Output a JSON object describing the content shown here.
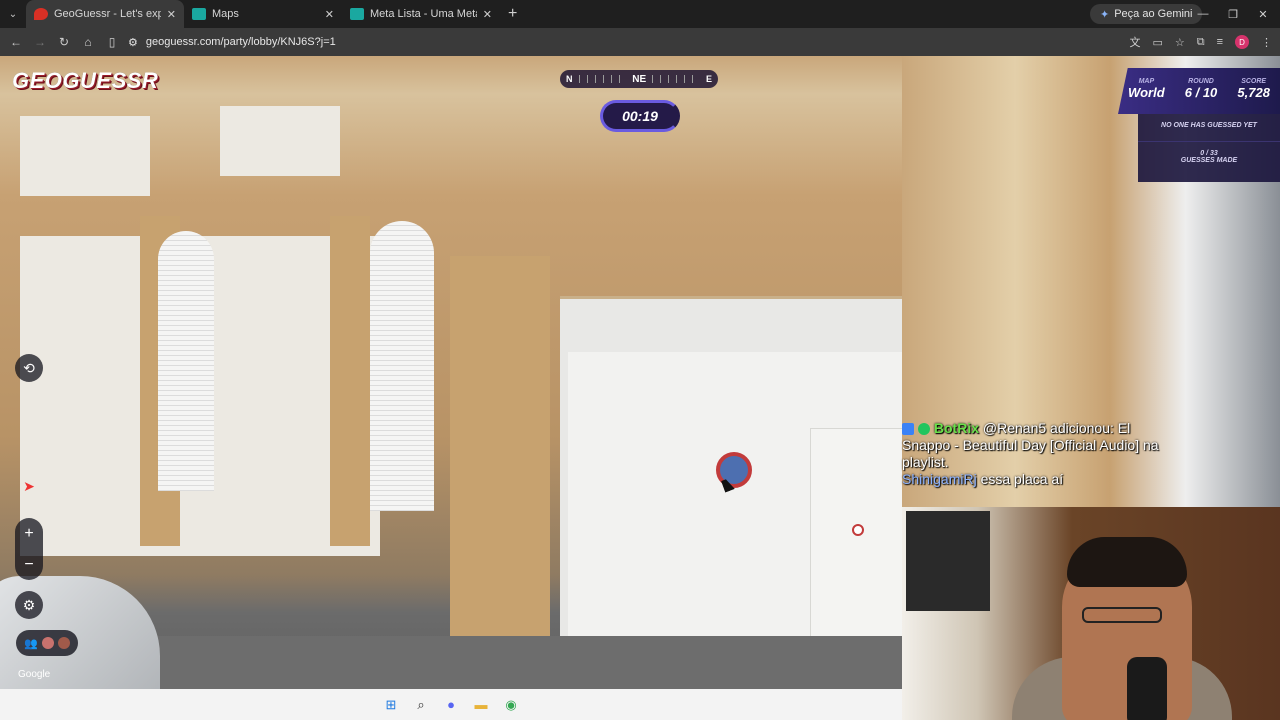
{
  "browser": {
    "tabs": [
      {
        "title": "GeoGuessr - Let's explore the w",
        "active": true,
        "favicon_color": "#d93025"
      },
      {
        "title": "Maps",
        "active": false,
        "favicon_color": "#1aa8a0"
      },
      {
        "title": "Meta Lista - Uma Meta Europa",
        "active": false,
        "favicon_color": "#1aa8a0"
      }
    ],
    "new_tab": "+",
    "gemini_label": "Peça ao Gemini",
    "url": "geoguessr.com/party/lobby/KNJ6S?j=1",
    "profile_initial": "D"
  },
  "game": {
    "logo": "GEOGUESSR",
    "compass": {
      "left": "N",
      "center": "NE",
      "right": "E"
    },
    "timer": "00:19",
    "scoreboard": {
      "map_label": "MAP",
      "map_value": "World",
      "round_label": "ROUND",
      "round_value": "6 / 10",
      "score_label": "SCORE",
      "score_value": "5,728"
    },
    "guess_status": "NO ONE HAS GUESSED YET",
    "guess_count": "0 / 33",
    "guess_count_label": "GUESSES MADE",
    "controls": {
      "zoom_in": "+",
      "zoom_out": "−"
    },
    "google": "Google"
  },
  "chat": {
    "messages": [
      {
        "user": "BotRix",
        "text": "@Renan5 adicionou: El Snappo - Beautiful Day [Official Audio] na playlist."
      },
      {
        "user": "ShinigamiRj",
        "text": "essa placa aí"
      }
    ]
  },
  "taskbar": {
    "icons": [
      "windows-icon",
      "search-icon",
      "discord-icon",
      "folder-icon",
      "chrome-icon"
    ]
  },
  "colors": {
    "accent": "#6a5be0",
    "panel": "#241a48"
  }
}
